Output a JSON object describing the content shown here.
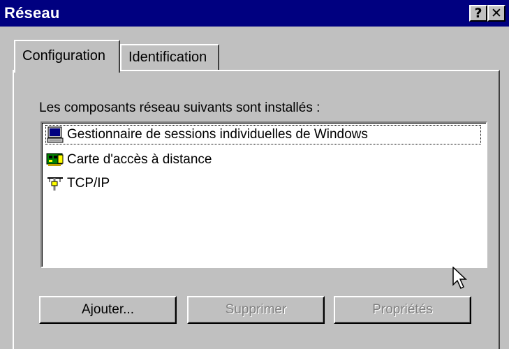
{
  "window": {
    "title": "Réseau"
  },
  "titlebar_buttons": {
    "help": "?",
    "close": "✕"
  },
  "tabs": [
    {
      "label": "Configuration",
      "active": true
    },
    {
      "label": "Identification",
      "active": false
    }
  ],
  "panel": {
    "label": "Les composants réseau suivants sont installés :"
  },
  "components": [
    {
      "label": "Gestionnaire de sessions individuelles de Windows",
      "icon": "computer-icon",
      "selected": true
    },
    {
      "label": "Carte d'accès à distance",
      "icon": "network-adapter-icon",
      "selected": false
    },
    {
      "label": "TCP/IP",
      "icon": "protocol-icon",
      "selected": false
    }
  ],
  "buttons": {
    "add": "Ajouter...",
    "remove": "Supprimer",
    "properties": "Propriétés"
  },
  "colors": {
    "titlebar": "#000080",
    "face": "#c0c0c0",
    "disabled_text": "#808080"
  }
}
